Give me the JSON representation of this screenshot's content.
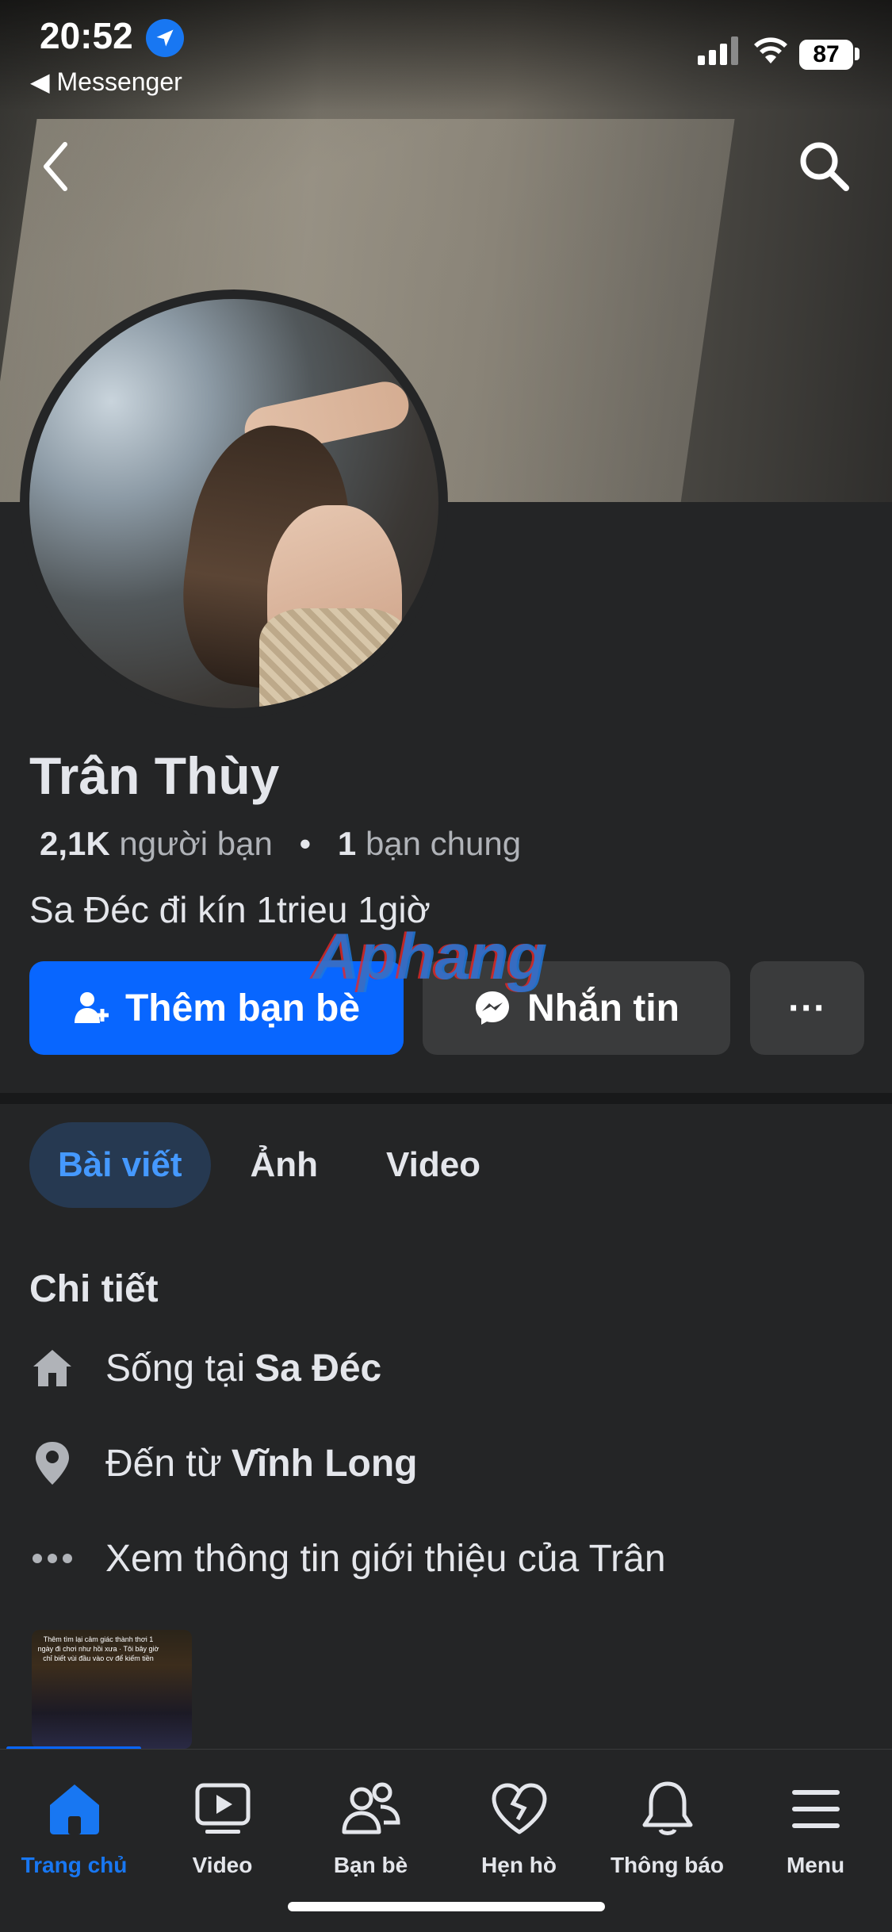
{
  "status_bar": {
    "time": "20:52",
    "back_app": "◀ Messenger",
    "battery": "87"
  },
  "profile": {
    "name": "Trân Thùy",
    "friends_count": "2,1K",
    "friends_label": "người bạn",
    "mutual_count": "1",
    "mutual_label": "bạn chung",
    "bio": "Sa Đéc đi kín 1trieu 1giờ"
  },
  "actions": {
    "add_friend": "Thêm bạn bè",
    "message": "Nhắn tin",
    "more": "···"
  },
  "watermark": "Aphang",
  "tabs": [
    {
      "label": "Bài viết",
      "active": true
    },
    {
      "label": "Ảnh",
      "active": false
    },
    {
      "label": "Video",
      "active": false
    }
  ],
  "details": {
    "title": "Chi tiết",
    "lives_prefix": "Sống tại",
    "lives_place": "Sa Đéc",
    "from_prefix": "Đến từ",
    "from_place": "Vĩnh Long",
    "about_link": "Xem thông tin giới thiệu của Trân"
  },
  "thumbnail_caption": "Thêm tìm lại cảm giác thành thơi 1 ngày đi chơi như hồi xưa · Tôi bây giờ chỉ biết vùi đầu vào cv để kiếm tiền",
  "bottom_nav": [
    {
      "label": "Trang chủ",
      "icon": "home-icon",
      "active": true
    },
    {
      "label": "Video",
      "icon": "video-icon",
      "active": false
    },
    {
      "label": "Bạn bè",
      "icon": "friends-icon",
      "active": false
    },
    {
      "label": "Hẹn hò",
      "icon": "dating-heart-icon",
      "active": false
    },
    {
      "label": "Thông báo",
      "icon": "bell-icon",
      "active": false
    },
    {
      "label": "Menu",
      "icon": "menu-icon",
      "active": false
    }
  ],
  "colors": {
    "accent": "#0866ff",
    "background": "#242526",
    "active_tab_bg": "#263951"
  }
}
